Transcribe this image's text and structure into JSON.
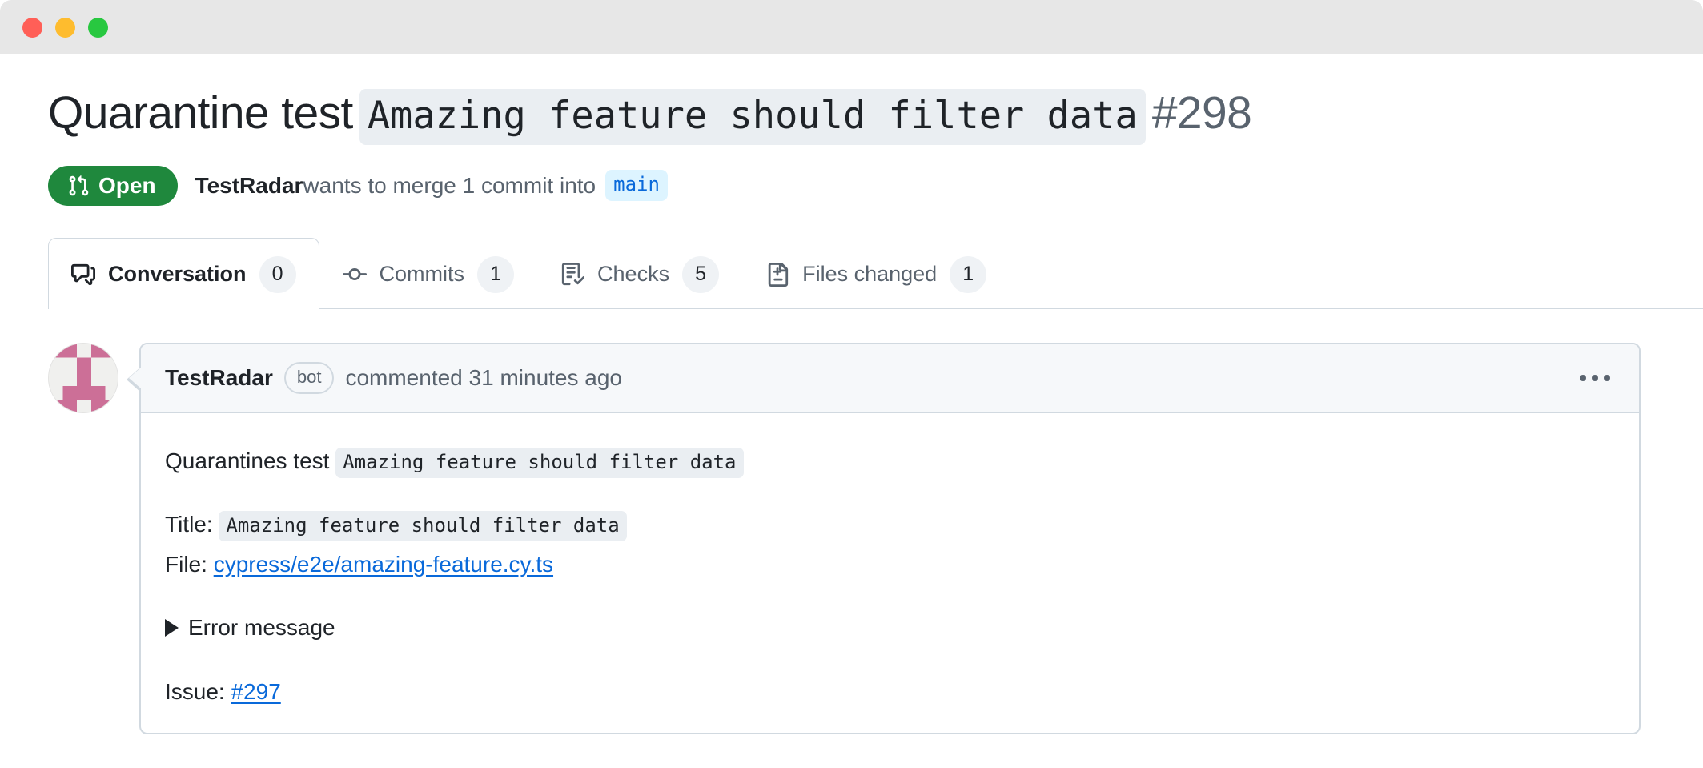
{
  "window": {
    "traffic_lights": [
      {
        "name": "close",
        "color": "#ff5f57"
      },
      {
        "name": "minimize",
        "color": "#febc2e"
      },
      {
        "name": "maximize",
        "color": "#28c840"
      }
    ],
    "chrome_color": "#e7e7e7"
  },
  "colors": {
    "open_green": "#1f883d",
    "link_blue": "#0969da",
    "branch_chip_bg": "#ddf4ff",
    "code_bg": "#eaeef2",
    "border": "#d1d9e0",
    "header_bg": "#f6f8fa",
    "muted_text": "#59636e",
    "text": "#1f2328",
    "avatar_accent": "#c9698f",
    "avatar_bg": "#f0f0ee"
  },
  "pr": {
    "title_prefix": "Quarantine test",
    "title_code": "Amazing feature should filter data",
    "number": "#298",
    "state_label": "Open",
    "state_icon": "git-pull-request-icon",
    "author": "TestRadar",
    "merge_text_before": " wants to merge 1 commit into ",
    "base_branch": "main"
  },
  "tabs": [
    {
      "label": "Conversation",
      "count": "0",
      "icon": "comment-discussion-icon",
      "active": true
    },
    {
      "label": "Commits",
      "count": "1",
      "icon": "git-commit-icon",
      "active": false
    },
    {
      "label": "Checks",
      "count": "5",
      "icon": "checklist-icon",
      "active": false
    },
    {
      "label": "Files changed",
      "count": "1",
      "icon": "file-diff-icon",
      "active": false
    }
  ],
  "comment": {
    "avatar_name": "identicon-avatar",
    "author": "TestRadar",
    "badge": "bot",
    "meta_suffix": "commented 31 minutes ago",
    "menu_icon": "kebab-horizontal-icon",
    "body": {
      "line1_prefix": "Quarantines test",
      "line1_code": "Amazing feature should filter data",
      "title_label": "Title:",
      "title_code": "Amazing feature should filter data",
      "file_label": "File:",
      "file_link": "cypress/e2e/amazing-feature.cy.ts",
      "details_summary": "Error message",
      "issue_label": "Issue:",
      "issue_link": "#297"
    }
  }
}
